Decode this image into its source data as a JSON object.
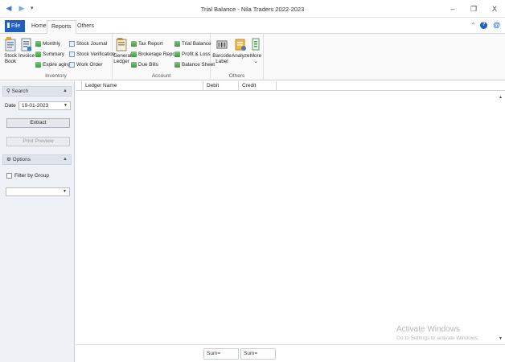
{
  "titlebar": {
    "title": "Trial Balance - Nila Traders 2022-2023",
    "back_icon": "back-arrow-icon",
    "forward_icon": "forward-arrow-icon",
    "qat_icon": "quick-access-dropdown-icon",
    "minimize": "–",
    "maximize": "❐",
    "close": "X"
  },
  "tabs": {
    "file": "File",
    "items": [
      "Home",
      "Reports",
      "Others"
    ],
    "active": "Reports",
    "collapse_icon": "^",
    "help": "?",
    "at": "@"
  },
  "ribbon": {
    "inventory": {
      "label": "Inventory",
      "stock_book": [
        "Stock",
        "Book"
      ],
      "invoice": "Invoice",
      "monthly": "Monthly",
      "summary": "Summary",
      "expire_aging": "Expire aging",
      "stock_journal": "Stock Journal",
      "stock_verification": "Stock Verification",
      "work_order": "Work Order"
    },
    "account": {
      "label": "Account",
      "general_ledger": [
        "General",
        "Ledger"
      ],
      "tax_report": "Tax Report",
      "brokerage_report": "Brokerage Report",
      "due_bills": "Due Bills",
      "trial_balance": "Trial Balance",
      "profit_loss": "Profit & Loss",
      "balance_sheet": "Balance Sheet"
    },
    "others": {
      "label": "Others",
      "barcode_label": [
        "Barcode",
        "Label"
      ],
      "analyze": "Analyze",
      "more": "More",
      "more_caret": "⌄"
    }
  },
  "leftpane": {
    "search_header": "Search",
    "date_label": "Date",
    "date_value": "19-01-2023",
    "extract": "Extract",
    "print_preview": "Print Preview",
    "options_header": "Options",
    "filter_by_group": "Filter by Group",
    "group_value": ""
  },
  "grid": {
    "columns": [
      "Ledger Name",
      "Debit",
      "Credit"
    ],
    "rows": [],
    "footer": [
      "Sum=",
      "Sum="
    ]
  },
  "watermark": {
    "line1": "Activate Windows",
    "line2": "Go to Settings to activate Windows."
  }
}
